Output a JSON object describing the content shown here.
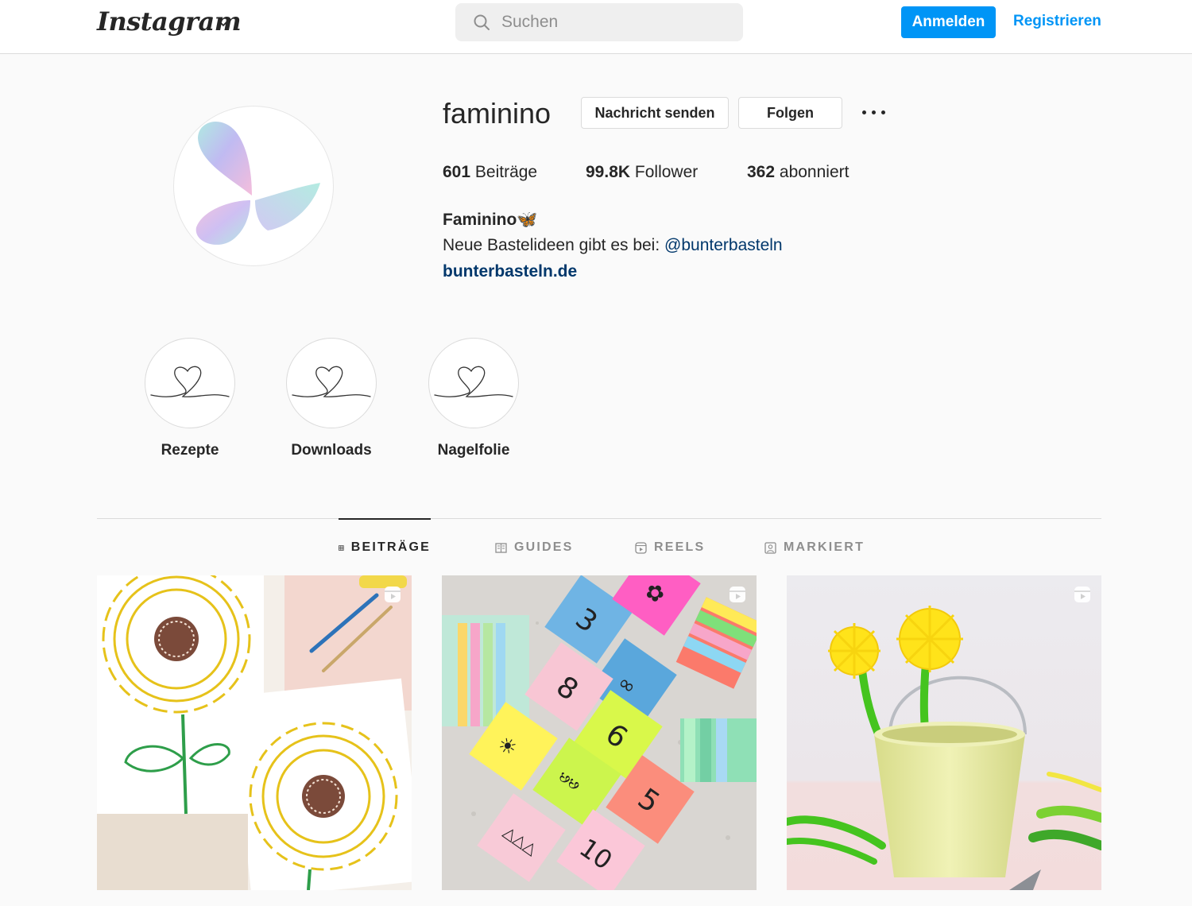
{
  "nav": {
    "logo": "Instagram",
    "search_placeholder": "Suchen",
    "login_label": "Anmelden",
    "register_label": "Registrieren"
  },
  "profile": {
    "username": "faminino",
    "message_label": "Nachricht senden",
    "follow_label": "Folgen",
    "stats": {
      "posts_count": "601",
      "posts_label": "Beiträge",
      "followers_count": "99.8K",
      "followers_label": "Follower",
      "following_count": "362",
      "following_label": "abonniert"
    },
    "full_name": "Faminino",
    "full_name_emoji": "🦋",
    "bio_text": "Neue Bastelideen gibt es bei: ",
    "bio_mention": "@bunterbasteln",
    "website": "bunterbasteln.de"
  },
  "highlights": [
    {
      "label": "Rezepte"
    },
    {
      "label": "Downloads"
    },
    {
      "label": "Nagelfolie"
    }
  ],
  "tabs": [
    {
      "label": "BEITRÄGE",
      "icon": "grid-icon",
      "active": true
    },
    {
      "label": "GUIDES",
      "icon": "guide-icon",
      "active": false
    },
    {
      "label": "REELS",
      "icon": "reels-icon",
      "active": false
    },
    {
      "label": "MARKIERT",
      "icon": "tagged-icon",
      "active": false
    }
  ],
  "posts": [
    {
      "subject": "sunflower drawings",
      "type": "reel"
    },
    {
      "subject": "colored number sticky notes",
      "type": "reel"
    },
    {
      "subject": "yarn dandelions in bucket",
      "type": "reel"
    }
  ],
  "colors": {
    "accent": "#0095f6",
    "link": "#00376b",
    "text": "#262626",
    "muted": "#8e8e8e",
    "border": "#dbdbdb"
  }
}
